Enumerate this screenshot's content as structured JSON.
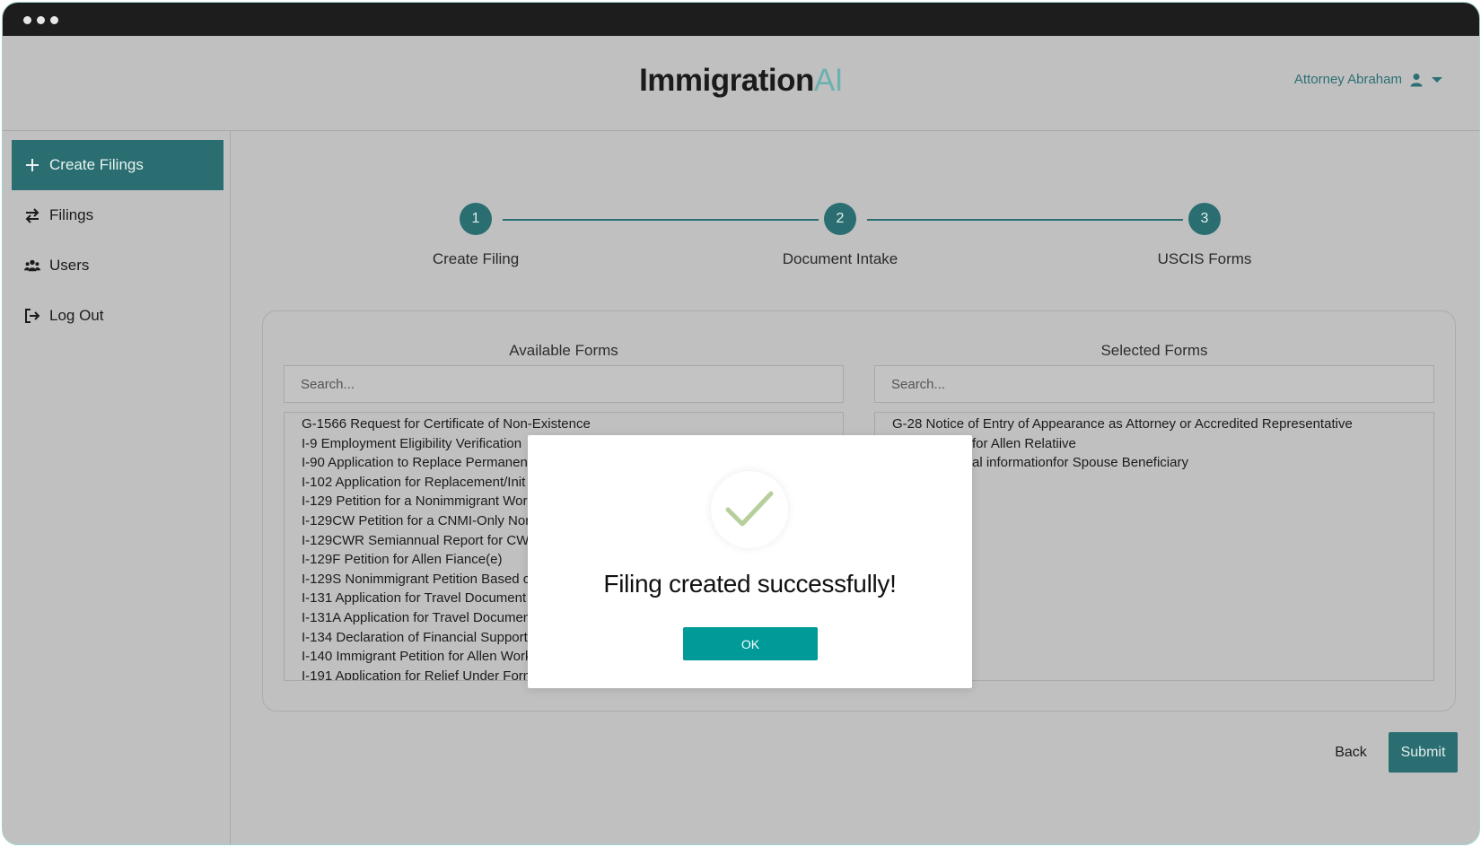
{
  "window": {
    "chrome_dots": 3
  },
  "brand": {
    "name": "Immigration",
    "suffix": "AI",
    "suffix_color": "#6bb2b0"
  },
  "user_menu": {
    "name": "Attorney Abraham"
  },
  "sidebar": {
    "items": [
      {
        "label": "Create Filings",
        "icon": "plus-icon",
        "active": true
      },
      {
        "label": "Filings",
        "icon": "swap-arrows-icon",
        "active": false
      },
      {
        "label": "Users",
        "icon": "users-icon",
        "active": false
      },
      {
        "label": "Log Out",
        "icon": "logout-icon",
        "active": false
      }
    ]
  },
  "stepper": {
    "steps": [
      {
        "number": "1",
        "label": "Create Filing"
      },
      {
        "number": "2",
        "label": "Document Intake"
      },
      {
        "number": "3",
        "label": "USCIS Forms"
      }
    ]
  },
  "available": {
    "title": "Available Forms",
    "search_placeholder": "Search...",
    "items": [
      "G-1566 Request for Certificate of Non-Existence",
      "I-9 Employment Eligibility Verification",
      "I-90 Application to Replace Permanen",
      "I-102 Application for Replacement/Init",
      "I-129 Petition for a Nonimmigrant Work",
      "I-129CW Petition for a CNMI-Only Non",
      "I-129CWR Semiannual Report for CW-",
      "I-129F Petition for Allen Fiance(e)",
      "I-129S Nonimmigrant Petition Based o",
      "I-131 Application for Travel Document",
      "I-131A Application for Travel Documen",
      "I-134 Declaration of Financial Support",
      "I-140 Immigrant Petition for Allen Work",
      "I-191 Application for Relief Under Form"
    ]
  },
  "selected": {
    "title": "Selected Forms",
    "search_placeholder": "Search...",
    "items": [
      "G-28 Notice of Entry of Appearance as Attorney or Accredited Representative",
      "for Allen Relatiive",
      "al informationfor Spouse Beneficiary"
    ]
  },
  "actions": {
    "back_label": "Back",
    "submit_label": "Submit"
  },
  "modal": {
    "message": "Filing created successfully!",
    "ok_label": "OK",
    "icon": "checkmark-icon",
    "accent": "#009a98",
    "check_color": "#b6cf9c"
  },
  "colors": {
    "primary": "#2a6e71",
    "background": "#c0c0c0"
  }
}
